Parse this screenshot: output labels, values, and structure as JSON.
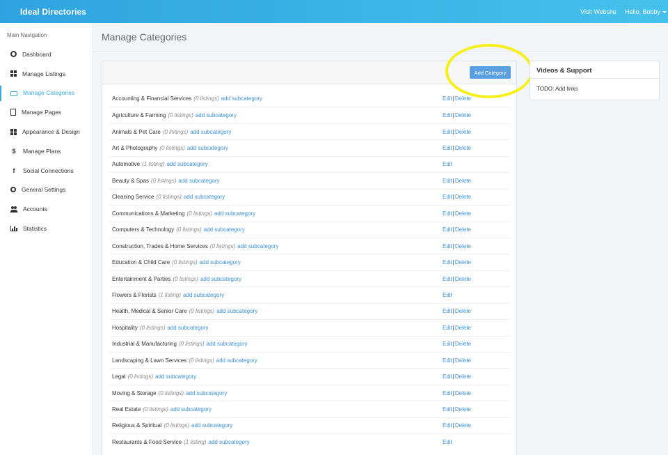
{
  "header": {
    "brand": "Ideal Directories",
    "visit_website": "Visit Website",
    "user_greeting": "Hello, Bobby"
  },
  "sidebar": {
    "heading": "Main Navigation",
    "items": [
      {
        "label": "Dashboard",
        "icon": "dashboard-icon"
      },
      {
        "label": "Manage Listings",
        "icon": "grid-icon"
      },
      {
        "label": "Manage Categories",
        "icon": "folder-open-icon",
        "active": true
      },
      {
        "label": "Manage Pages",
        "icon": "page-icon"
      },
      {
        "label": "Appearance & Design",
        "icon": "grid-icon"
      },
      {
        "label": "Manage Plans",
        "icon": "dollar-icon"
      },
      {
        "label": "Social Connections",
        "icon": "facebook-icon"
      },
      {
        "label": "General Settings",
        "icon": "gears-icon"
      },
      {
        "label": "Accounts",
        "icon": "users-icon"
      },
      {
        "label": "Statistics",
        "icon": "area-chart-icon"
      }
    ]
  },
  "main": {
    "title": "Manage Categories",
    "add_category_label": "Add Category",
    "edit_label": "Edit",
    "delete_label": "Delete",
    "add_sub_label": "add subcategory",
    "categories": [
      {
        "name": "Accounting & Financial Services",
        "count": "(0 listings)",
        "deletable": true
      },
      {
        "name": "Agriculture & Farming",
        "count": "(0 listings)",
        "deletable": true
      },
      {
        "name": "Animals & Pet Care",
        "count": "(0 listings)",
        "deletable": true
      },
      {
        "name": "Art & Photography",
        "count": "(0 listings)",
        "deletable": true
      },
      {
        "name": "Automotive",
        "count": "(1 listing)",
        "deletable": false
      },
      {
        "name": "Beauty & Spas",
        "count": "(0 listings)",
        "deletable": true
      },
      {
        "name": "Cleaning Service",
        "count": "(0 listings)",
        "deletable": true
      },
      {
        "name": "Communications & Marketing",
        "count": "(0 listings)",
        "deletable": true
      },
      {
        "name": "Computers & Technology",
        "count": "(0 listings)",
        "deletable": true
      },
      {
        "name": "Construction, Trades & Home Services",
        "count": "(0 listings)",
        "deletable": true
      },
      {
        "name": "Education & Child Care",
        "count": "(0 listings)",
        "deletable": true
      },
      {
        "name": "Entertainment & Parties",
        "count": "(0 listings)",
        "deletable": true
      },
      {
        "name": "Flowers & Florists",
        "count": "(1 listing)",
        "deletable": false
      },
      {
        "name": "Health, Medical & Senior Care",
        "count": "(0 listings)",
        "deletable": true
      },
      {
        "name": "Hospitality",
        "count": "(0 listings)",
        "deletable": true
      },
      {
        "name": "Industrial & Manufacturing",
        "count": "(0 listings)",
        "deletable": true
      },
      {
        "name": "Landscaping & Lawn Services",
        "count": "(0 listings)",
        "deletable": true
      },
      {
        "name": "Legal",
        "count": "(0 listings)",
        "deletable": true
      },
      {
        "name": "Moving & Storage",
        "count": "(0 listings)",
        "deletable": true
      },
      {
        "name": "Real Estate",
        "count": "(0 listings)",
        "deletable": true
      },
      {
        "name": "Religious & Spiritual",
        "count": "(0 listings)",
        "deletable": true
      },
      {
        "name": "Restaurants & Food Service",
        "count": "(1 listing)",
        "deletable": false
      }
    ]
  },
  "side_panel": {
    "title": "Videos & Support",
    "body": "TODO: Add links"
  },
  "colors": {
    "accent": "#3aa8de",
    "link": "#3a8fd6",
    "button": "#5aa0e0",
    "highlight": "#f5f01a"
  }
}
